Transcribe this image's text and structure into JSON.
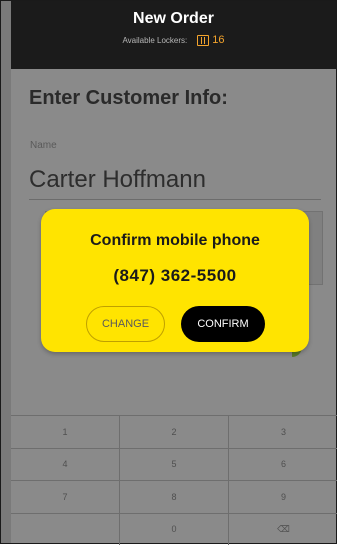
{
  "header": {
    "title": "New Order",
    "available_lockers_label": "Available Lockers:",
    "available_lockers_count": "16",
    "locker_icon": "locker-icon"
  },
  "form": {
    "section_title": "Enter Customer Info:",
    "name_label": "Name",
    "name_value": "Carter Hoffmann"
  },
  "modal": {
    "title": "Confirm mobile phone",
    "phone": "(847) 362-5500",
    "change_label": "CHANGE",
    "confirm_label": "CONFIRM"
  },
  "keypad": {
    "keys": [
      "1",
      "2",
      "3",
      "4",
      "5",
      "6",
      "7",
      "8",
      "9",
      "",
      "0",
      "⌫"
    ]
  },
  "colors": {
    "accent": "#ffe400",
    "locker_orange": "#f3a32c",
    "header_bg": "#1b1b1b"
  }
}
